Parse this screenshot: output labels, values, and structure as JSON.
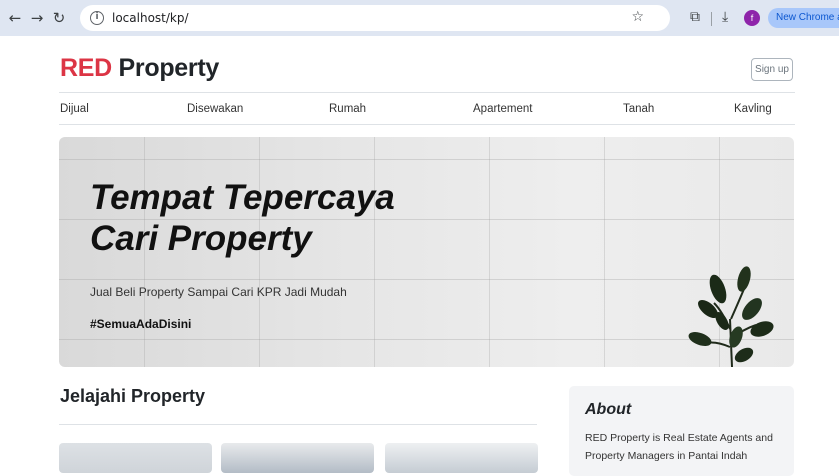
{
  "browser": {
    "url": "localhost/kp/",
    "update_label": "New Chrome available",
    "profile_initial": "f"
  },
  "header": {
    "brand_red": "RED",
    "brand_rest": "Property",
    "signup_label": "Sign up"
  },
  "nav": {
    "items": [
      "Dijual",
      "Disewakan",
      "Rumah",
      "Apartement",
      "Tanah",
      "Kavling"
    ]
  },
  "hero": {
    "title_line1": "Tempat Tepercaya",
    "title_line2": "Cari Property",
    "subtitle": "Jual Beli Property Sampai Cari KPR Jadi Mudah",
    "hashtag": "#SemuaAdaDisini"
  },
  "main": {
    "section_title": "Jelajahi Property"
  },
  "about": {
    "title": "About",
    "text": "RED Property is Real Estate Agents and Property Managers in Pantai Indah"
  },
  "colors": {
    "brand_red": "#dc3545"
  }
}
